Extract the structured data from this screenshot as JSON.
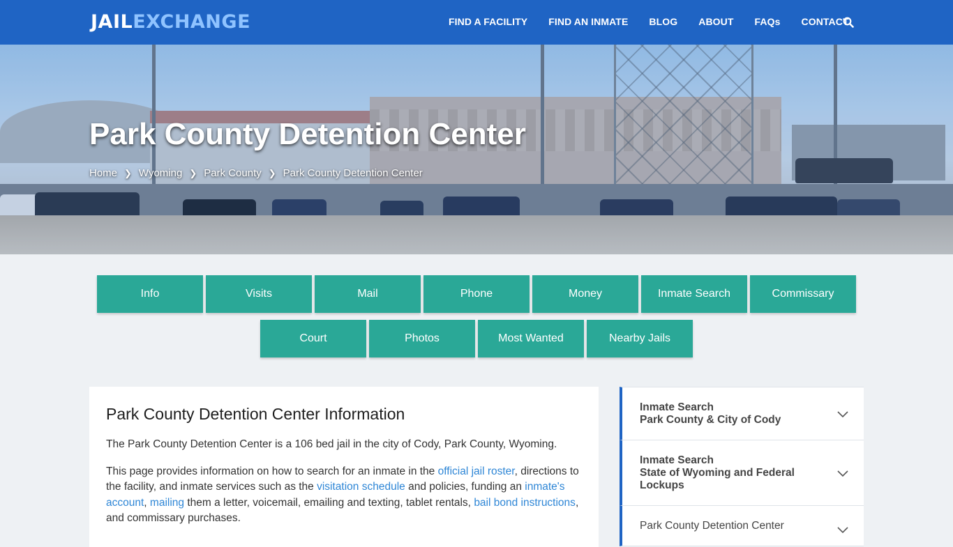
{
  "header": {
    "logo_part1": "JAIL",
    "logo_part2": "EXCHANGE",
    "nav": [
      "FIND A FACILITY",
      "FIND AN INMATE",
      "BLOG",
      "ABOUT",
      "FAQs",
      "CONTACT"
    ],
    "search_icon": "search-icon"
  },
  "hero": {
    "title": "Park County Detention Center",
    "breadcrumbs": [
      "Home",
      "Wyoming",
      "Park County",
      "Park County Detention Center"
    ]
  },
  "buttons": {
    "row1": [
      "Info",
      "Visits",
      "Mail",
      "Phone",
      "Money",
      "Inmate Search",
      "Commissary"
    ],
    "row2": [
      "Court",
      "Photos",
      "Most Wanted",
      "Nearby Jails"
    ]
  },
  "main": {
    "heading": "Park County Detention Center Information",
    "p1": "The Park County Detention Center is a 106 bed jail in the city of Cody, Park County, Wyoming.",
    "p2": {
      "t1": "This page provides information on how to search for an inmate in the ",
      "link1": "official jail roster",
      "t2": ", directions to the facility, and inmate services such as the ",
      "link2": "visitation schedule",
      "t3": " and policies, funding an ",
      "link3": "inmate's account",
      "t4": ", ",
      "link4": "mailing",
      "t5": " them a letter, voicemail, emailing and texting, tablet rentals, ",
      "link5": "bail bond instructions",
      "t6": ", and commissary purchases."
    }
  },
  "sidebar": {
    "items": [
      {
        "line1": "Inmate Search",
        "line2": "Park County & City of Cody"
      },
      {
        "line1": "Inmate Search",
        "line2": "State of Wyoming and Federal Lockups"
      },
      {
        "line1": "Park County Detention Center",
        "line2": ""
      }
    ]
  },
  "colors": {
    "header_bg": "#1f64c4",
    "button_bg": "#2aa897",
    "link": "#2e86d6"
  }
}
